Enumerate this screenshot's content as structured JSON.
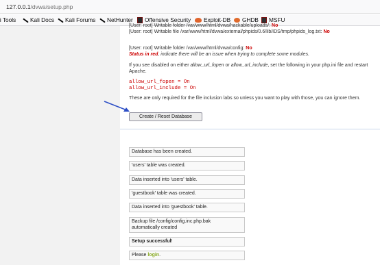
{
  "browser": {
    "url_host": "127.0.0.1",
    "url_path": "/dvwa/setup.php"
  },
  "bookmarks": [
    {
      "label": "li Tools",
      "icon": "kali-icon"
    },
    {
      "label": "Kali Docs",
      "icon": "kali-icon"
    },
    {
      "label": "Kali Forums",
      "icon": "kali-icon"
    },
    {
      "label": "NetHunter",
      "icon": "kali-icon"
    },
    {
      "label": "Offensive Security",
      "icon": "offsec-icon"
    },
    {
      "label": "Exploit-DB",
      "icon": "exploitdb-icon"
    },
    {
      "label": "GHDB",
      "icon": "ghdb-icon"
    },
    {
      "label": "MSFU",
      "icon": "msfu-icon"
    }
  ],
  "checks": {
    "line1": "[User: root] Writable folder /var/www/html/dvwa/hackable/uploads/: ",
    "line1_status": "No",
    "line2": "[User: root] Writable file /var/www/html/dvwa/external/phpids/0.6/lib/IDS/tmp/phpids_log.txt: ",
    "line2_status": "No",
    "line3": "[User: root] Writable folder /var/www/html/dvwa/config: ",
    "line3_status": "No",
    "status_red": "Status in red",
    "status_note": ", indicate there will be an issue when trying to complete some modules."
  },
  "instructions": {
    "intro_a": "If you see disabled on either ",
    "fopen": "allow_url_fopen",
    "intro_b": " or ",
    "include": "allow_url_include",
    "intro_c": ", set the following in your php.ini file and restart",
    "intro_d": "Apache.",
    "code1": "allow_url_fopen = On",
    "code2": "allow_url_include = On",
    "note": "These are only required for the file inclusion labs so unless you want to play with those, you can ignore them."
  },
  "button": {
    "label": "Create / Reset Database"
  },
  "messages": {
    "m1": "Database has been created.",
    "m2": "'users' table was created.",
    "m3": "Data inserted into 'users' table.",
    "m4": "'guestbook' table was created.",
    "m5": "Data inserted into 'guestbook' table.",
    "m6a": "Backup file /config/config.inc.php.bak",
    "m6b": "automatically created",
    "m7_bold": "Setup successful",
    "m7_end": "!",
    "m8_pre": "Please ",
    "m8_link": "login",
    "m8_end": "."
  },
  "colors": {
    "status_red": "#cc0000",
    "link_green": "#88aa22",
    "arrow_blue": "#2d4fc6"
  }
}
